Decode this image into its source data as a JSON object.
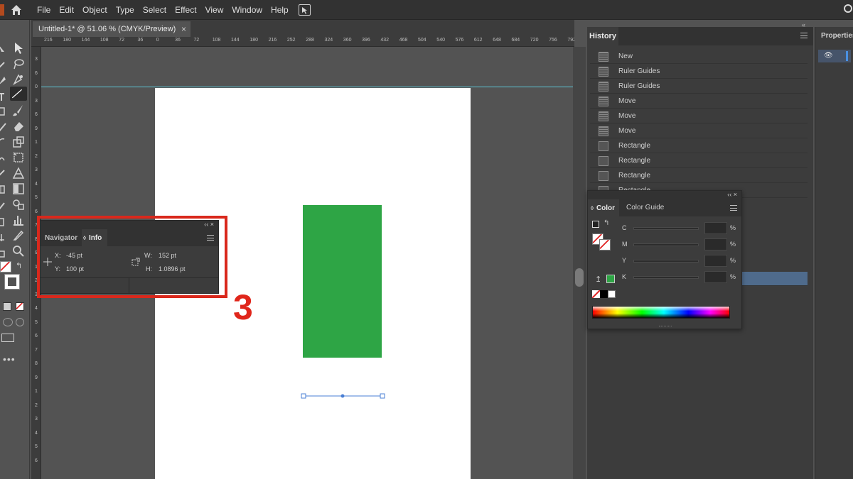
{
  "menubar": {
    "items": [
      "File",
      "Edit",
      "Object",
      "Type",
      "Select",
      "Effect",
      "View",
      "Window",
      "Help"
    ]
  },
  "document": {
    "tab_title": "Untitled-1* @ 51.06 % (CMYK/Preview)",
    "close_glyph": "×"
  },
  "rulers": {
    "horizontal": [
      "216",
      "180",
      "144",
      "108",
      "72",
      "36",
      "0",
      "36",
      "72",
      "108",
      "144",
      "180",
      "216",
      "252",
      "288",
      "324",
      "360",
      "396",
      "432",
      "468",
      "504",
      "540",
      "576",
      "612",
      "648",
      "684",
      "720",
      "756",
      "792"
    ],
    "vertical": [
      "3",
      "6",
      "0",
      "3",
      "6",
      "9",
      "1",
      "2",
      "3",
      "4",
      "5",
      "6",
      "7",
      "8",
      "9",
      "1",
      "2",
      "3",
      "4",
      "5",
      "6",
      "7",
      "8",
      "9",
      "1",
      "2",
      "3",
      "4",
      "5",
      "6"
    ]
  },
  "history": {
    "tab_label": "History",
    "collapse_glyph": "«",
    "items": [
      {
        "label": "New",
        "icon": "document-icon"
      },
      {
        "label": "Ruler Guides",
        "icon": "document-icon"
      },
      {
        "label": "Ruler Guides",
        "icon": "document-icon"
      },
      {
        "label": "Move",
        "icon": "document-icon"
      },
      {
        "label": "Move",
        "icon": "document-icon"
      },
      {
        "label": "Move",
        "icon": "document-icon"
      },
      {
        "label": "Rectangle",
        "icon": "step-icon"
      },
      {
        "label": "Rectangle",
        "icon": "step-icon"
      },
      {
        "label": "Rectangle",
        "icon": "step-icon"
      },
      {
        "label": "Rectangle",
        "icon": "step-icon"
      }
    ]
  },
  "properties": {
    "title": "Properties",
    "eye_glyph": "👁"
  },
  "color_panel": {
    "tab_active": "Color",
    "tab_other": "Color Guide",
    "controls": "‹‹  ×",
    "channels": [
      {
        "channel": "C",
        "unit": "%"
      },
      {
        "channel": "M",
        "unit": "%"
      },
      {
        "channel": "Y",
        "unit": "%"
      },
      {
        "channel": "K",
        "unit": "%"
      }
    ],
    "fill_color": "#2ea545"
  },
  "info_panel": {
    "tab_other": "Navigator",
    "tab_active": "Info",
    "controls": "‹‹  ×",
    "x_label": "X:",
    "x_value": "-45 pt",
    "y_label": "Y:",
    "y_value": "100 pt",
    "w_label": "W:",
    "w_value": "152 pt",
    "h_label": "H:",
    "h_value": "1.0896 pt"
  },
  "annotation": {
    "step_number": "3",
    "highlight_color": "#d9281c"
  },
  "artwork": {
    "rectangle_color": "#2ea545",
    "guide_color": "#5cc6d6",
    "selection_color": "#4a7fd4"
  }
}
